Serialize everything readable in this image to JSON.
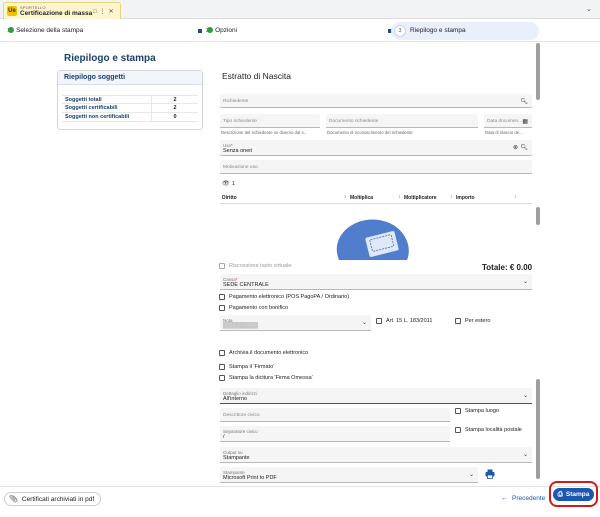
{
  "tab": {
    "subtitle": "SPORTELLO",
    "title": "Certificazione di massa",
    "logo": "Ue",
    "icons": [
      "copy-icon",
      "more-icon",
      "close-icon"
    ],
    "chevron": "chevron-down-icon"
  },
  "stepper": {
    "steps": [
      {
        "num": "1",
        "label": "Selezione della stampa",
        "done": true
      },
      {
        "num": "2",
        "label": "Opzioni",
        "done": true
      },
      {
        "num": "3",
        "label": "Riepilogo e stampa",
        "active": true
      }
    ]
  },
  "left": {
    "title": "Riepilogo e stampa",
    "card_title": "Riepilogo soggetti",
    "rows": [
      {
        "label": "Soggetti totali",
        "value": "2"
      },
      {
        "label": "Soggetti certificabili",
        "value": "2"
      },
      {
        "label": "Soggetti non certificabili",
        "value": "0"
      }
    ]
  },
  "form": {
    "section_title": "Estratto di Nascita",
    "richiedente_placeholder": "Richiedente",
    "tipo_placeholder": "Tipo richiedente",
    "doc_placeholder": "Documento richiedente",
    "data_placeholder": "Data documen...",
    "tipo_hint": "Descrizione del richiedente se diverso dal s...",
    "doc_hint": "Documento di riconoscimento del richiedente",
    "data_hint": "Data di rilascio de...",
    "uso_label": "Uso",
    "uso_value": "Senza oneri",
    "motivazione_placeholder": "Motivazione uso",
    "visibility_count": "1",
    "grid_cols": [
      "Diritto",
      "Moltiplica",
      "Moltiplicatore",
      "Importo"
    ],
    "riscossione_label": "Riscossione tasto virtuale",
    "totale": "Totale: € 0.00",
    "cassa_label": "Cassa",
    "cassa_value": "SEDE CENTRALE",
    "pagamento_elettronico": "Pagamento elettronico (POS PagoPA / Ordinario)",
    "pagamento_bonifico": "Pagamento con bonifico",
    "notes_label": "Nota",
    "notes_value": "█████████",
    "art_label": "Art. 15 L. 183/2011",
    "per_estero_label": "Per estero",
    "archivia_label": "Archivia il documento elettronico",
    "firmato_label": "Stampa il 'Firmato'",
    "firma_omessa_label": "Stampa la dicitura 'Firma Omessa'",
    "dettaglio_label": "Dettaglio indirizzi",
    "dettaglio_value": "All'interno",
    "descrittore_placeholder": "Descrittore civico",
    "stampa_luogo_label": "Stampa luogo",
    "separatore_label": "Separatore civico",
    "separatore_value": "/",
    "stampa_localita_label": "Stampa località postale",
    "output_label": "Output su",
    "output_value": "Stampante",
    "stampante_label": "Stampante",
    "stampante_value": "Microsoft Print to PDF"
  },
  "footer": {
    "archive_label": "Certificati archiviati in pdf",
    "prev_label": "Precedente",
    "print_label": "Stampa"
  },
  "colors": {
    "accent": "#1a56b4",
    "title": "#1c3f6e",
    "highlight": "#d21a1a",
    "success": "#2e9d3f",
    "tab_bg": "#fff6cf"
  }
}
